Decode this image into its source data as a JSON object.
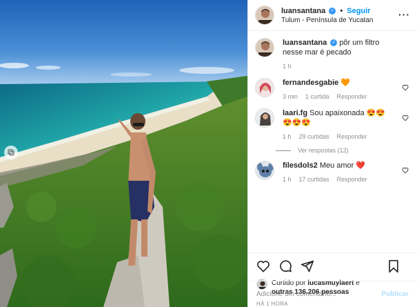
{
  "post": {
    "author": "luansantana",
    "follow_label": "Seguir",
    "location": "Tulum - Península de Yucatan",
    "more_icon": "more-horizontal-icon"
  },
  "caption": {
    "username": "luansantana",
    "text": "pôr um filtro nesse mar é pecado",
    "time": "1 h"
  },
  "comments": [
    {
      "username": "fernandesgabie",
      "text": "",
      "emoji": "🧡",
      "time": "3 min",
      "likes": "1 curtida",
      "reply": "Responder"
    },
    {
      "username": "laari.fg",
      "text": "Sou apaixonada",
      "emoji": "😍😍",
      "emoji2": "😍😍😍",
      "time": "1 h",
      "likes": "29 curtidas",
      "reply": "Responder",
      "view_replies": "Ver respostas (12)"
    },
    {
      "username": "filesdols2",
      "text": "Meu amor",
      "emoji": "❤️",
      "time": "1 h",
      "likes": "17 curtidas",
      "reply": "Responder"
    }
  ],
  "likes": {
    "prefix": "Curtido por",
    "user": "lucasmuylaert",
    "mid": "e",
    "others": "outras 136.206 pessoas"
  },
  "timestamp": "HÁ 1 HORA",
  "add_comment": {
    "placeholder": "Adicione um comentário...",
    "publish_label": "Publicar"
  },
  "colors": {
    "accent": "#0095f6",
    "verified": "#3897f0",
    "publish_disabled": "#b2dffc"
  }
}
